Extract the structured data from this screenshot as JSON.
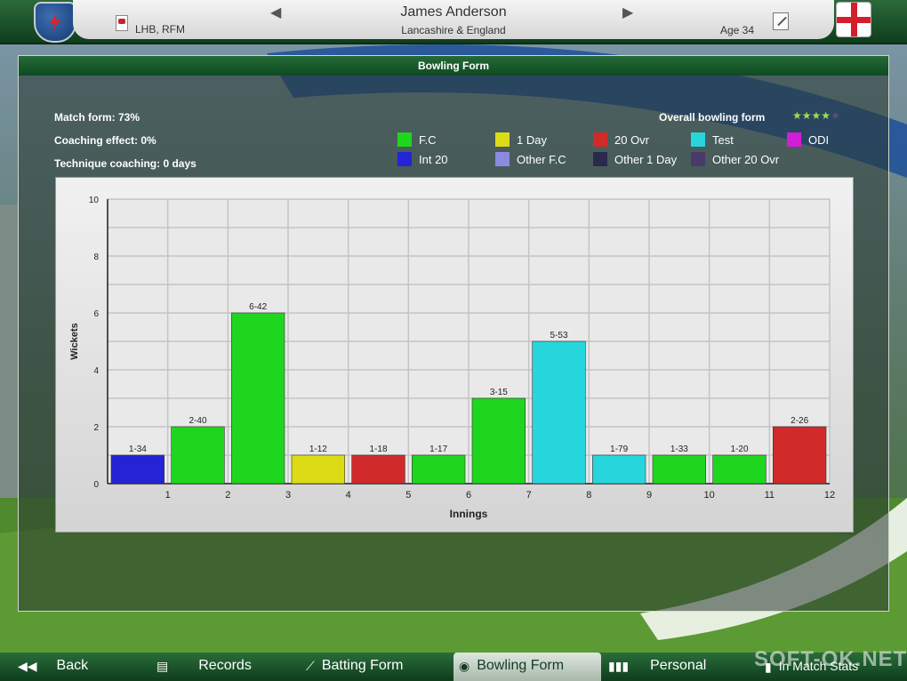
{
  "header": {
    "style": "LHB, RFM",
    "player_name": "James Anderson",
    "team": "Lancashire & England",
    "age": "Age 34"
  },
  "panel": {
    "title": "Bowling Form",
    "match_form": "Match form: 73%",
    "coaching_effect": "Coaching effect: 0%",
    "technique_coaching": "Technique coaching: 0 days",
    "overall_label": "Overall bowling form",
    "overall_stars": "★★★★"
  },
  "legend": [
    {
      "label": "F.C",
      "color": "#1fd61f"
    },
    {
      "label": "1 Day",
      "color": "#dcdc16"
    },
    {
      "label": "20 Ovr",
      "color": "#d12a2a"
    },
    {
      "label": "Test",
      "color": "#27d6dc"
    },
    {
      "label": "ODI",
      "color": "#d21dd8"
    },
    {
      "label": "Int 20",
      "color": "#2424d6"
    },
    {
      "label": "Other F.C",
      "color": "#8a8ae0"
    },
    {
      "label": "Other 1 Day",
      "color": "#2a2a4a"
    },
    {
      "label": "Other 20 Ovr",
      "color": "#4a3a6a"
    }
  ],
  "chart_data": {
    "type": "bar",
    "xlabel": "Innings",
    "ylabel": "Wickets",
    "ylim": [
      0,
      10
    ],
    "yticks": [
      0,
      2,
      4,
      6,
      8,
      10
    ],
    "categories": [
      "1",
      "2",
      "3",
      "4",
      "5",
      "6",
      "7",
      "8",
      "9",
      "10",
      "11",
      "12"
    ],
    "values": [
      1,
      2,
      6,
      1,
      1,
      1,
      3,
      5,
      1,
      1,
      1,
      2
    ],
    "labels": [
      "1-34",
      "2-40",
      "6-42",
      "1-12",
      "1-18",
      "1-17",
      "3-15",
      "5-53",
      "1-79",
      "1-33",
      "1-20",
      "2-26"
    ],
    "format": [
      "Int 20",
      "F.C",
      "F.C",
      "1 Day",
      "20 Ovr",
      "F.C",
      "F.C",
      "Test",
      "Test",
      "F.C",
      "F.C",
      "20 Ovr"
    ],
    "grid": true
  },
  "nav": [
    {
      "label": "Back",
      "icon": "back-arrows-icon"
    },
    {
      "label": "Records",
      "icon": "records-icon"
    },
    {
      "label": "Batting Form",
      "icon": "batting-icon"
    },
    {
      "label": "Bowling Form",
      "icon": "bowling-icon",
      "active": true
    },
    {
      "label": "Personal",
      "icon": "personal-icon"
    },
    {
      "label": "In Match Stats",
      "icon": "match-stats-icon"
    }
  ],
  "watermark": "SOFT-OK.NET"
}
